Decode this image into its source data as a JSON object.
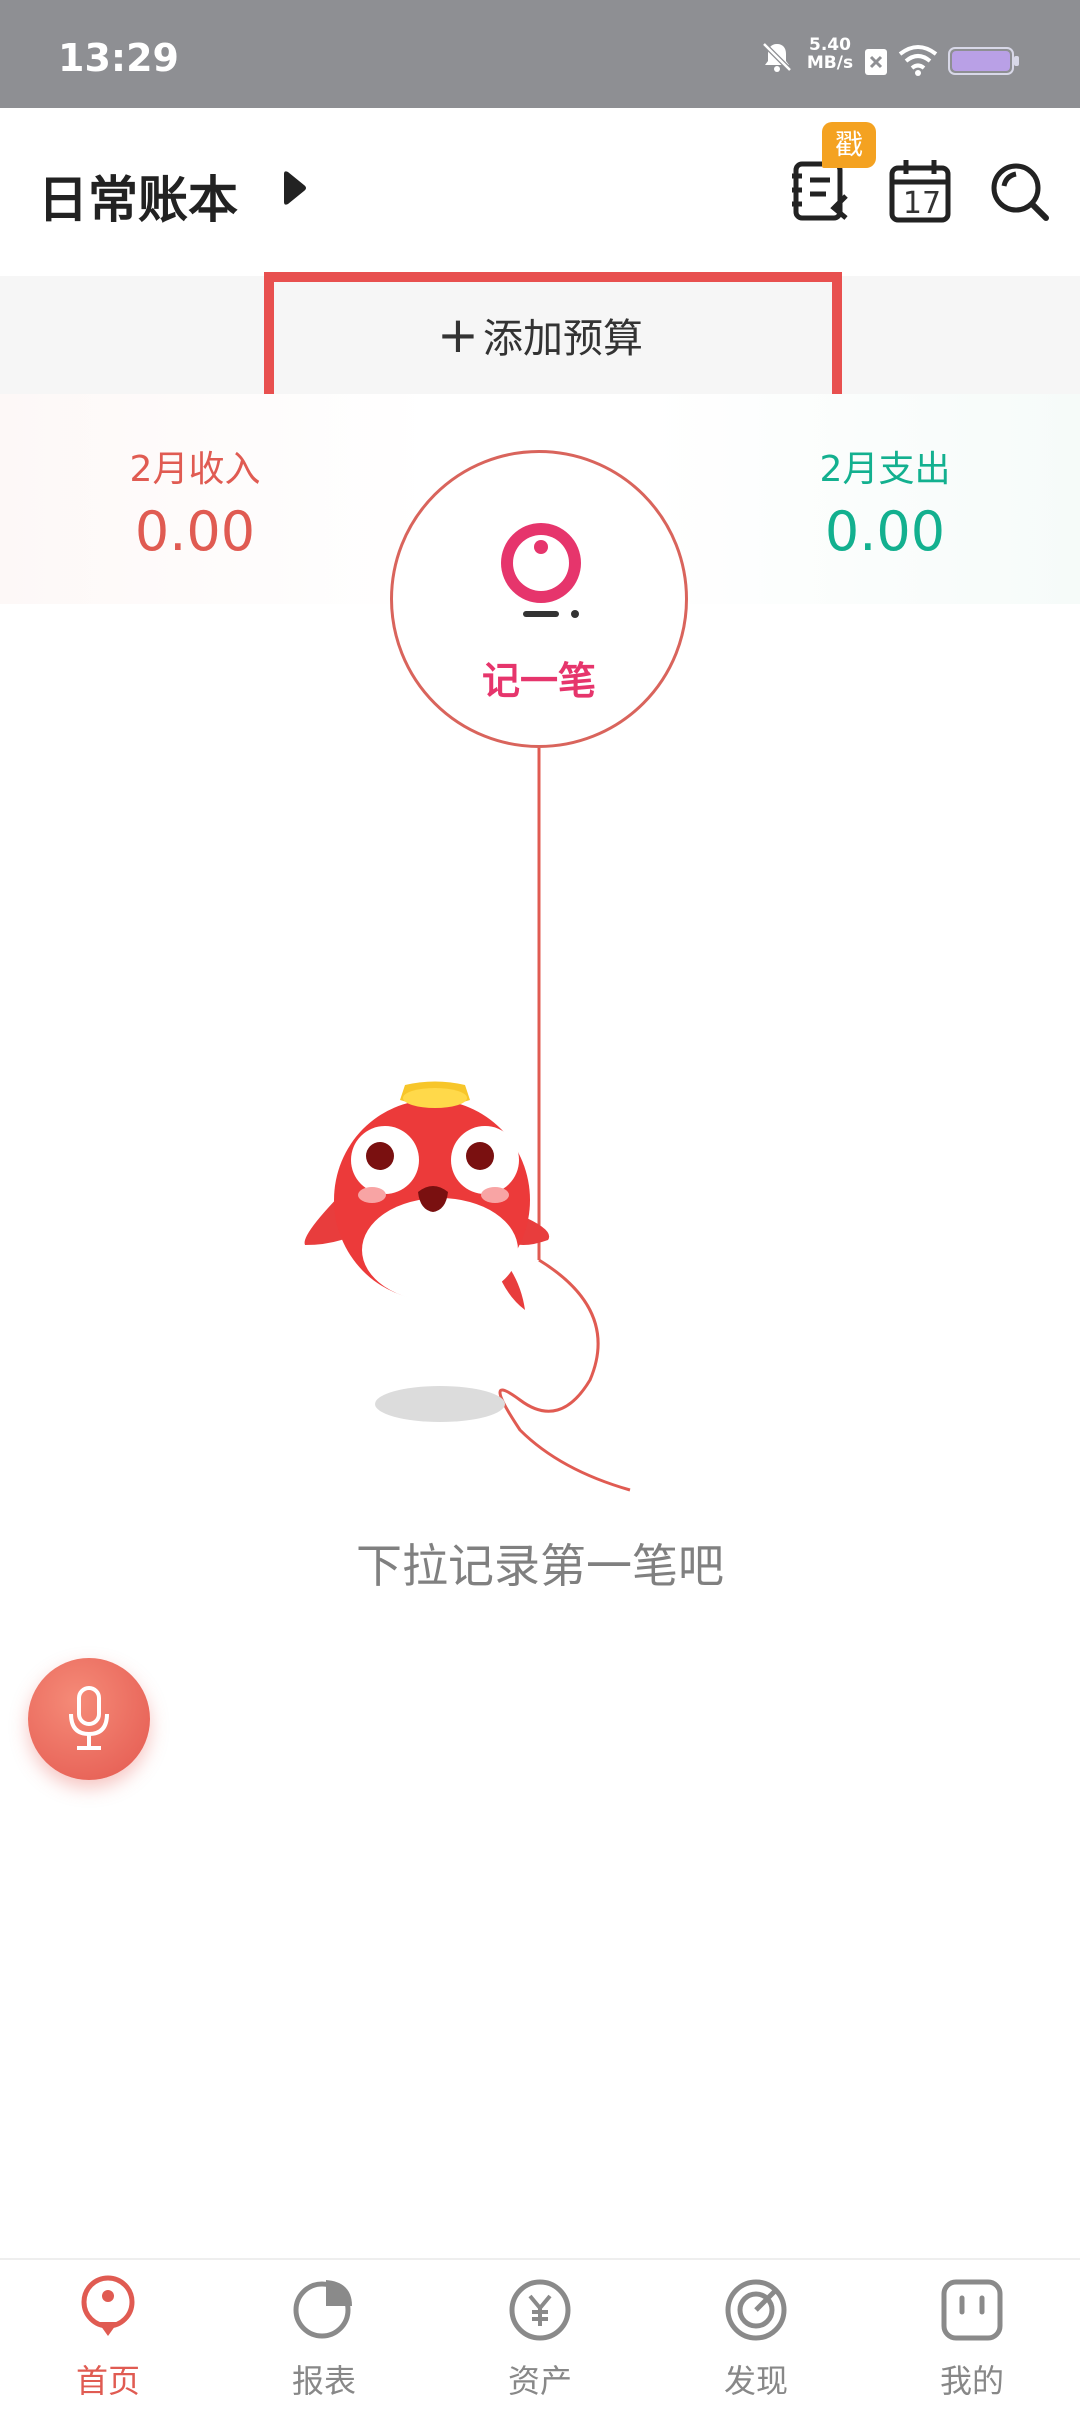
{
  "status_bar": {
    "time": "13:29",
    "net_speed": "5.40",
    "net_unit": "MB/s",
    "icons": [
      "mute-bell-icon",
      "sim-x-icon",
      "wifi-icon",
      "battery-icon"
    ]
  },
  "header": {
    "book_title": "日常账本",
    "badge": "戳",
    "calendar_day": "17",
    "icons": [
      "arrow-right-icon",
      "notes-icon",
      "calendar-icon",
      "search-icon"
    ]
  },
  "budget": {
    "plus": "+",
    "label": "添加预算"
  },
  "summary": {
    "income_label": "2月收入",
    "income_value": "0.00",
    "expense_label": "2月支出",
    "expense_value": "0.00"
  },
  "record": {
    "label": "记一笔"
  },
  "empty_hint": "下拉记录第一笔吧",
  "nav": {
    "items": [
      {
        "label": "首页",
        "icon": "home-pin-icon",
        "active": true
      },
      {
        "label": "报表",
        "icon": "pie-chart-icon",
        "active": false
      },
      {
        "label": "资产",
        "icon": "yen-coin-icon",
        "active": false
      },
      {
        "label": "发现",
        "icon": "target-icon",
        "active": false
      },
      {
        "label": "我的",
        "icon": "profile-face-icon",
        "active": false
      }
    ]
  },
  "colors": {
    "accent": "#e05b52",
    "income": "#e05b52",
    "expense": "#13b08f",
    "highlight": "#e8504f",
    "badge": "#f4a221"
  }
}
